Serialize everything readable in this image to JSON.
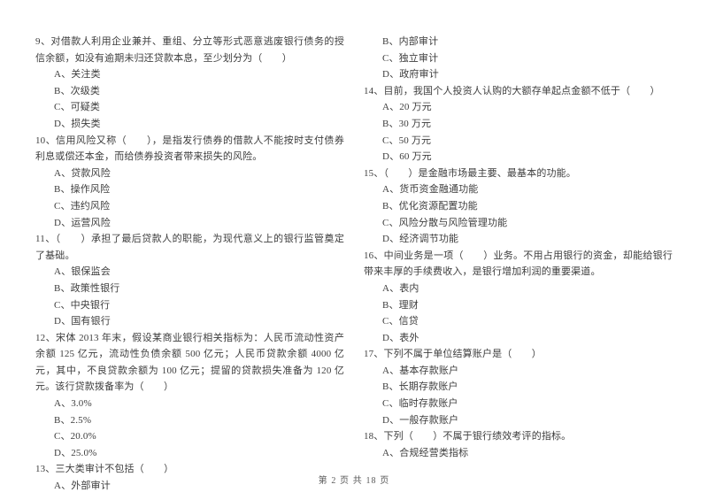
{
  "document": {
    "type": "exam-paper",
    "language": "zh-CN"
  },
  "columns": {
    "left": [
      {
        "number": "9",
        "stem": "9、对借款人利用企业兼并、重组、分立等形式恶意逃废银行债务的授信余额，如没有逾期未归还贷款本息，至少划分为（　　）",
        "options": [
          "A、关注类",
          "B、次级类",
          "C、可疑类",
          "D、损失类"
        ]
      },
      {
        "number": "10",
        "stem": "10、信用风险又称（　　），是指发行债券的借款人不能按时支付债券利息或偿还本金，而给债券投资者带来损失的风险。",
        "options": [
          "A、贷款风险",
          "B、操作风险",
          "C、违约风险",
          "D、运营风险"
        ]
      },
      {
        "number": "11",
        "stem": "11、（　　）承担了最后贷款人的职能，为现代意义上的银行监管奠定了基础。",
        "options": [
          "A、银保监会",
          "B、政策性银行",
          "C、中央银行",
          "D、国有银行"
        ]
      },
      {
        "number": "12",
        "stem": "12、宋体 2013 年末，假设某商业银行相关指标为：人民币流动性资产余额 125 亿元，流动性负债余额 500 亿元；人民币贷款余额 4000 亿元，其中，不良贷款余额为 100 亿元；提留的贷款损失准备为 120 亿元。该行贷款拨备率为（　　）",
        "options": [
          "A、3.0%",
          "B、2.5%",
          "C、20.0%",
          "D、25.0%"
        ]
      },
      {
        "number": "13",
        "stem": "13、三大类审计不包括（　　）",
        "options": [
          "A、外部审计"
        ]
      }
    ],
    "right": [
      {
        "number": "13-cont",
        "stem": "",
        "options": [
          "B、内部审计",
          "C、独立审计",
          "D、政府审计"
        ]
      },
      {
        "number": "14",
        "stem": "14、目前，我国个人投资人认购的大额存单起点金额不低于（　　）",
        "options": [
          "A、20 万元",
          "B、30 万元",
          "C、50 万元",
          "D、60 万元"
        ]
      },
      {
        "number": "15",
        "stem": "15、（　　）是金融市场最主要、最基本的功能。",
        "options": [
          "A、货币资金融通功能",
          "B、优化资源配置功能",
          "C、风险分散与风险管理功能",
          "D、经济调节功能"
        ]
      },
      {
        "number": "16",
        "stem": "16、中间业务是一项（　　）业务。不用占用银行的资金，却能给银行带来丰厚的手续费收入，是银行增加利润的重要渠道。",
        "options": [
          "A、表内",
          "B、理财",
          "C、信贷",
          "D、表外"
        ]
      },
      {
        "number": "17",
        "stem": "17、下列不属于单位结算账户是（　　）",
        "options": [
          "A、基本存款账户",
          "B、长期存款账户",
          "C、临时存款账户",
          "D、一般存款账户"
        ]
      },
      {
        "number": "18",
        "stem": "18、下列（　　）不属于银行绩效考评的指标。",
        "options": [
          "A、合规经营类指标"
        ]
      }
    ]
  },
  "footer": {
    "page_label": "第 2 页 共 18 页"
  }
}
